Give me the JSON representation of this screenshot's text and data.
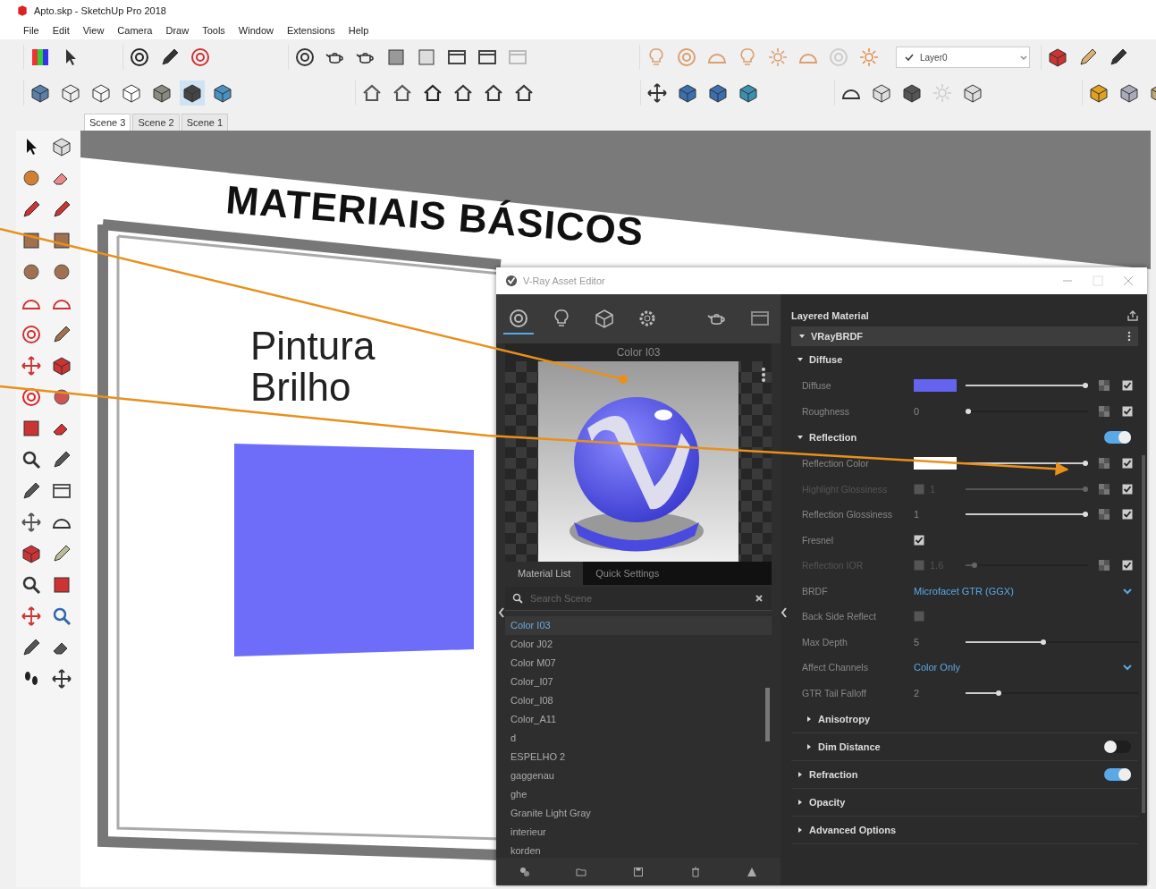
{
  "window": {
    "title": "Apto.skp - SketchUp Pro 2018"
  },
  "menu": [
    "File",
    "Edit",
    "View",
    "Camera",
    "Draw",
    "Tools",
    "Window",
    "Extensions",
    "Help"
  ],
  "style_toolbar": [
    {
      "selected": false
    },
    {
      "selected": false
    },
    {
      "selected": false
    },
    {
      "selected": false
    },
    {
      "selected": false
    },
    {
      "selected": true
    },
    {
      "selected": false
    }
  ],
  "layer_dropdown": {
    "value": "Layer0"
  },
  "scene_tabs": [
    {
      "label": "Scene 3",
      "selected": true
    },
    {
      "label": "Scene 2",
      "selected": false
    },
    {
      "label": "Scene 1",
      "selected": false
    }
  ],
  "model": {
    "heading": "MATERIAIS BÁSICOS",
    "label": "Pintura Brilho"
  },
  "asset_editor": {
    "title": "V-Ray Asset Editor",
    "category_tabs": [
      {
        "selected": true
      },
      {
        "selected": false
      },
      {
        "selected": false
      },
      {
        "selected": false
      }
    ],
    "preview_title": "Color I03",
    "list_tabs": [
      {
        "label": "Material List",
        "selected": true
      },
      {
        "label": "Quick Settings",
        "selected": false
      }
    ],
    "search": {
      "placeholder": "Search Scene"
    },
    "materials": [
      {
        "name": "Color I03",
        "selected": true
      },
      {
        "name": "Color J02",
        "selected": false
      },
      {
        "name": "Color M07",
        "selected": false
      },
      {
        "name": "Color_I07",
        "selected": false
      },
      {
        "name": "Color_I08",
        "selected": false
      },
      {
        "name": "Color_A11",
        "selected": false
      },
      {
        "name": "d",
        "selected": false
      },
      {
        "name": "ESPELHO 2",
        "selected": false
      },
      {
        "name": "gaggenau",
        "selected": false
      },
      {
        "name": "ghe",
        "selected": false
      },
      {
        "name": "Granite Light Gray",
        "selected": false
      },
      {
        "name": "interieur",
        "selected": false
      },
      {
        "name": "korden",
        "selected": false
      }
    ],
    "material_type": "Layered Material",
    "layer": {
      "name": "VRayBRDF",
      "expanded": true,
      "sections": [
        {
          "title": "Diffuse",
          "expanded": true,
          "rows": [
            {
              "kind": "color",
              "label": "Diffuse",
              "color": "#6464f0",
              "level": 1,
              "map_on": true
            },
            {
              "kind": "slider",
              "label": "Roughness",
              "value": "0",
              "level": 0,
              "map_on": true
            }
          ]
        },
        {
          "title": "Reflection",
          "expanded": true,
          "on": true,
          "rows": [
            {
              "kind": "color",
              "label": "Reflection Color",
              "color": "#ffffff",
              "level": 1,
              "map_on": true
            },
            {
              "kind": "slider",
              "label": "Highlight Glossiness",
              "locked": false,
              "value": "1",
              "level": 1,
              "map_on": true,
              "disabled": true
            },
            {
              "kind": "slider",
              "label": "Reflection Glossiness",
              "value": "1",
              "level": 1,
              "map_on": true
            },
            {
              "kind": "checkbox",
              "label": "Fresnel",
              "checked": true
            },
            {
              "kind": "slider",
              "label": "Reflection IOR",
              "locked": false,
              "value": "1.6",
              "level": 0.05,
              "map_on": true,
              "disabled": true
            },
            {
              "kind": "dropdown",
              "label": "BRDF",
              "value": "Microfacet GTR (GGX)"
            },
            {
              "kind": "checkbox",
              "label": "Back Side Reflect",
              "checked": false
            },
            {
              "kind": "slider",
              "label": "Max Depth",
              "value": "5",
              "level": 0.45
            },
            {
              "kind": "dropdown",
              "label": "Affect Channels",
              "value": "Color Only"
            },
            {
              "kind": "slider",
              "label": "GTR Tail Falloff",
              "value": "2",
              "level": 0.18
            }
          ],
          "subsections": [
            {
              "title": "Anisotropy",
              "expanded": false
            },
            {
              "title": "Dim Distance",
              "expanded": false,
              "on": false
            }
          ]
        },
        {
          "title": "Refraction",
          "expanded": false,
          "on": true
        },
        {
          "title": "Opacity",
          "expanded": false
        },
        {
          "title": "Advanced Options",
          "expanded": false
        }
      ]
    }
  }
}
